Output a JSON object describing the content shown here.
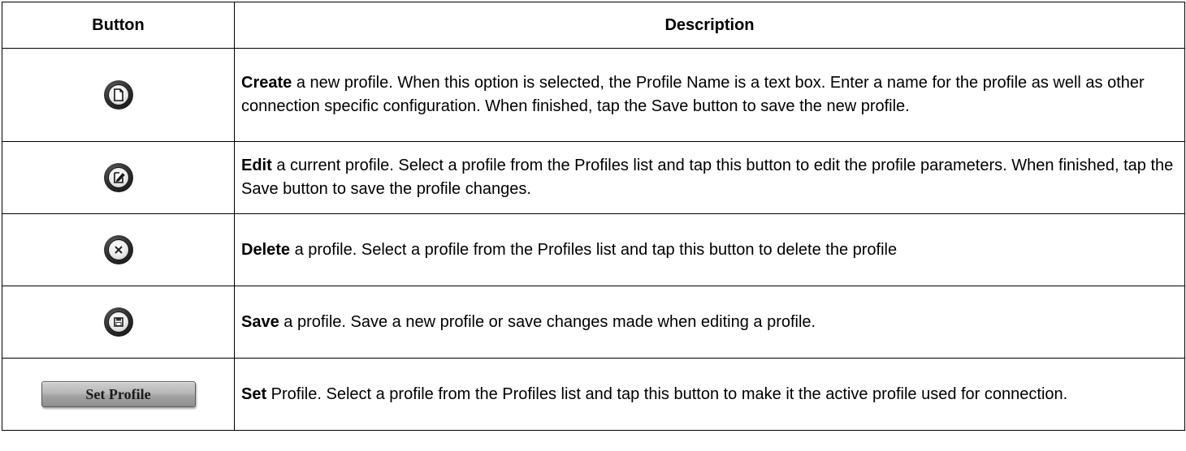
{
  "table": {
    "headers": {
      "button": "Button",
      "description": "Description"
    },
    "rows": [
      {
        "icon": "new-document-icon",
        "keyword": "Create",
        "text": " a new profile. When this option is selected, the Profile Name is a text box. Enter a name for the profile as well as other connection specific configuration. When finished, tap the Save button to save the new profile."
      },
      {
        "icon": "edit-icon",
        "keyword": "Edit",
        "text": " a current profile. Select a profile from the Profiles list and tap this button to edit the profile parameters. When finished, tap the Save button to save the profile changes."
      },
      {
        "icon": "delete-icon",
        "keyword": "Delete",
        "text": " a profile. Select a profile from the Profiles list and tap this button to delete the profile"
      },
      {
        "icon": "save-icon",
        "keyword": "Save",
        "text": " a profile. Save a new profile or save changes made when editing a profile."
      },
      {
        "button_label": "Set Profile",
        "keyword": "Set",
        "text": " Profile. Select a profile from the Profiles list and tap this button to make it the active profile used for connection."
      }
    ]
  }
}
